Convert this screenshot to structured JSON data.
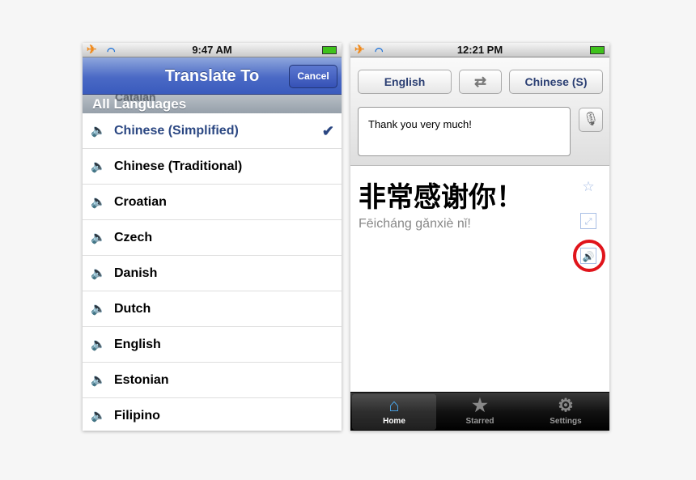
{
  "left": {
    "status": {
      "time": "9:47 AM"
    },
    "nav": {
      "title": "Translate To",
      "cancel": "Cancel"
    },
    "section_header": "All Languages",
    "ghost_item": "Catalan",
    "languages": [
      {
        "name": "Chinese (Simplified)",
        "speech": true,
        "selected": true
      },
      {
        "name": "Chinese (Traditional)",
        "speech": true,
        "selected": false
      },
      {
        "name": "Croatian",
        "speech": false,
        "selected": false
      },
      {
        "name": "Czech",
        "speech": true,
        "selected": false
      },
      {
        "name": "Danish",
        "speech": true,
        "selected": false
      },
      {
        "name": "Dutch",
        "speech": true,
        "selected": false
      },
      {
        "name": "English",
        "speech": true,
        "selected": false
      },
      {
        "name": "Estonian",
        "speech": false,
        "selected": false
      },
      {
        "name": "Filipino",
        "speech": false,
        "selected": false
      }
    ]
  },
  "right": {
    "status": {
      "time": "12:21 PM"
    },
    "source_lang": "English",
    "target_lang": "Chinese (S)",
    "input_text": "Thank you very much!",
    "translation": "非常感谢你！",
    "pinyin": "Fēicháng gǎnxiè nǐ!",
    "tabs": [
      {
        "label": "Home",
        "icon": "house-icon",
        "active": true
      },
      {
        "label": "Starred",
        "icon": "star-icon",
        "active": false
      },
      {
        "label": "Settings",
        "icon": "gear-icon",
        "active": false
      }
    ]
  },
  "colors": {
    "nav_blue": "#4a69c5",
    "selected_text": "#2b4782",
    "highlight_ring": "#e0141b"
  }
}
